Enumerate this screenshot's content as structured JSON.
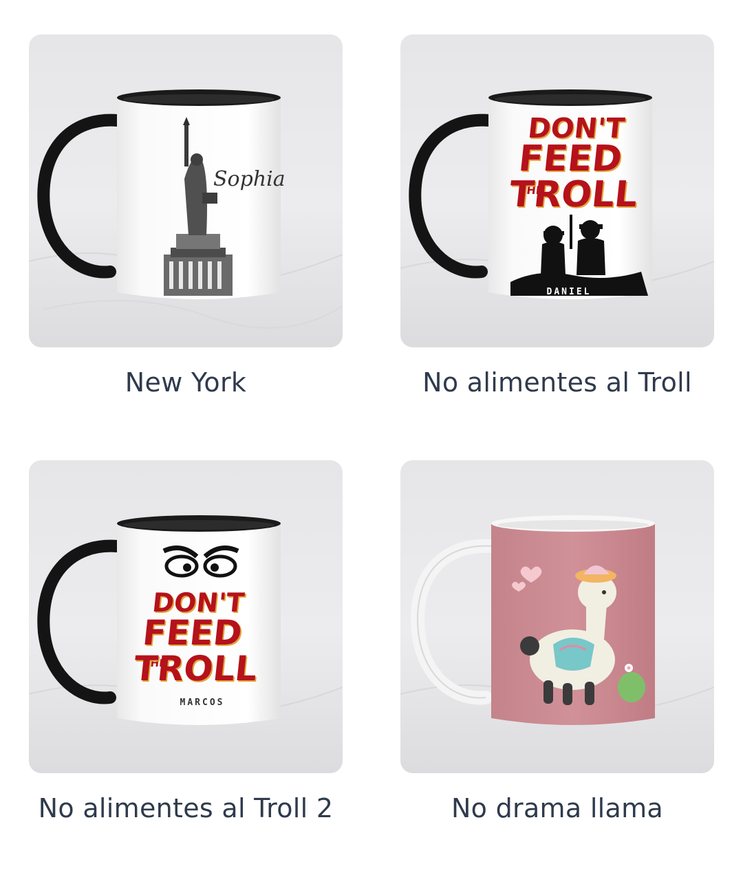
{
  "products": [
    {
      "name": "New York",
      "mug_style": "black-inner-handle",
      "design": "statue-of-liberty",
      "design_text": [
        "Sophia"
      ]
    },
    {
      "name": "No alimentes al Troll",
      "mug_style": "black-inner-handle",
      "design": "dont-feed-the-troll-silhouette",
      "design_text": [
        "DON'T",
        "FEED",
        "THE",
        "TROLL",
        "DANIEL"
      ]
    },
    {
      "name": "No alimentes al Troll 2",
      "mug_style": "black-inner-handle",
      "design": "dont-feed-the-troll-eyes",
      "design_text": [
        "DON'T",
        "FEED",
        "THE",
        "TROLL",
        "MARCOS"
      ]
    },
    {
      "name": "No drama llama",
      "mug_style": "white",
      "design": "llama-on-pink",
      "design_text": []
    }
  ],
  "colors": {
    "label": "#2f3a4c",
    "troll_red": "#b5121b",
    "troll_shadow": "#e3a33b",
    "llama_bg": "#cf8e95"
  }
}
